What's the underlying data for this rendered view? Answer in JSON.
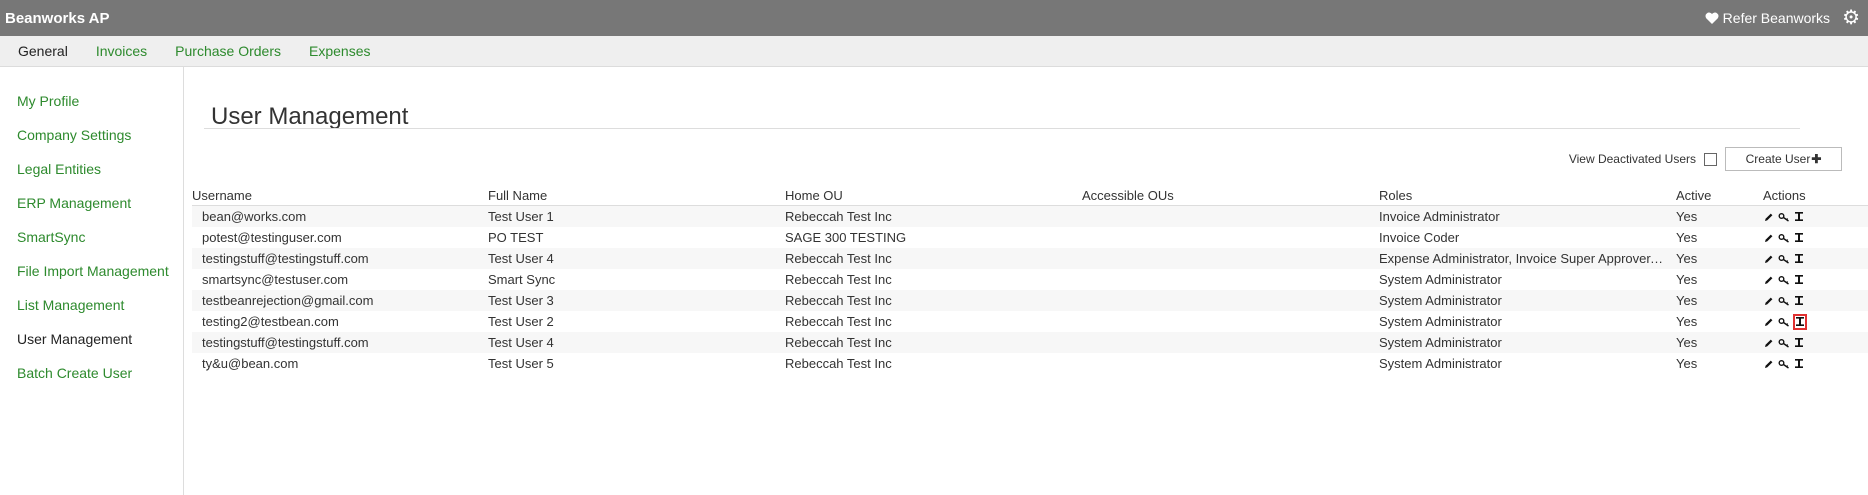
{
  "app": {
    "title": "Beanworks AP",
    "refer_label": "Refer Beanworks"
  },
  "nav": {
    "tabs": [
      {
        "label": "General",
        "active": true
      },
      {
        "label": "Invoices"
      },
      {
        "label": "Purchase Orders"
      },
      {
        "label": "Expenses"
      }
    ]
  },
  "sidebar": {
    "items": [
      {
        "label": "My Profile"
      },
      {
        "label": "Company Settings"
      },
      {
        "label": "Legal Entities"
      },
      {
        "label": "ERP Management"
      },
      {
        "label": "SmartSync"
      },
      {
        "label": "File Import Management"
      },
      {
        "label": "List Management"
      },
      {
        "label": "User Management",
        "active": true
      },
      {
        "label": "Batch Create User"
      }
    ]
  },
  "page": {
    "title": "User Management"
  },
  "toolbar": {
    "view_deactivated_label": "View Deactivated Users",
    "create_user_label": "Create User"
  },
  "table": {
    "headers": {
      "username": "Username",
      "full_name": "Full Name",
      "home_ou": "Home OU",
      "accessible_ous": "Accessible OUs",
      "roles": "Roles",
      "active": "Active",
      "actions": "Actions"
    },
    "rows": [
      {
        "username": "bean@works.com",
        "full_name": "Test User 1",
        "home_ou": "Rebeccah Test Inc",
        "accessible_ous": "",
        "roles": "Invoice Administrator",
        "active": "Yes"
      },
      {
        "username": "potest@testinguser.com",
        "full_name": "PO TEST",
        "home_ou": "SAGE 300 TESTING",
        "accessible_ous": "",
        "roles": "Invoice Coder",
        "active": "Yes"
      },
      {
        "username": "testingstuff@testingstuff.com",
        "full_name": "Test User 4",
        "home_ou": "Rebeccah Test Inc",
        "accessible_ous": "",
        "roles": "Expense Administrator, Invoice Super Approver, ...",
        "active": "Yes"
      },
      {
        "username": "smartsync@testuser.com",
        "full_name": "Smart Sync",
        "home_ou": "Rebeccah Test Inc",
        "accessible_ous": "",
        "roles": "System Administrator",
        "active": "Yes"
      },
      {
        "username": "testbeanrejection@gmail.com",
        "full_name": "Test User 3",
        "home_ou": "Rebeccah Test Inc",
        "accessible_ous": "",
        "roles": "System Administrator",
        "active": "Yes"
      },
      {
        "username": "testing2@testbean.com",
        "full_name": "Test User 2",
        "home_ou": "Rebeccah Test Inc",
        "accessible_ous": "",
        "roles": "System Administrator",
        "active": "Yes",
        "highlight_deactivate": true
      },
      {
        "username": "testingstuff@testingstuff.com",
        "full_name": "Test User 4",
        "home_ou": "Rebeccah Test Inc",
        "accessible_ous": "",
        "roles": "System Administrator",
        "active": "Yes"
      },
      {
        "username": "ty&u@bean.com",
        "full_name": "Test User 5",
        "home_ou": "Rebeccah Test Inc",
        "accessible_ous": "",
        "roles": "System Administrator",
        "active": "Yes"
      }
    ]
  },
  "icons": {
    "heart": "heart-icon",
    "gear": "gear-icon",
    "edit": "pencil-icon",
    "key": "key-icon",
    "deactivate": "deactivate-user-icon",
    "plus": "plus-icon"
  },
  "colors": {
    "topbar": "#777777",
    "link": "#2d8a2d",
    "highlight": "#e03030"
  }
}
